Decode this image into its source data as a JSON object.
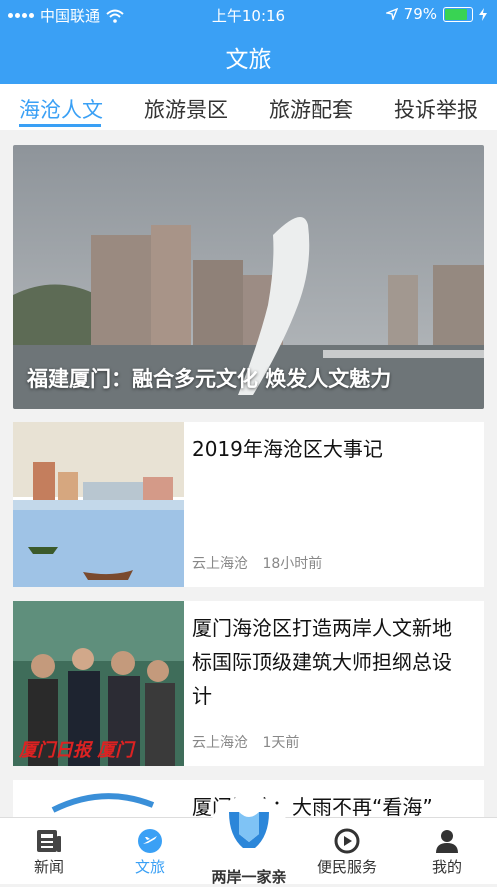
{
  "status_bar": {
    "carrier": "中国联通",
    "time": "上午10:16",
    "battery": "79%"
  },
  "header": {
    "title": "文旅"
  },
  "tabs": [
    {
      "label": "海沧人文",
      "active": true
    },
    {
      "label": "旅游景区",
      "active": false
    },
    {
      "label": "旅游配套",
      "active": false
    },
    {
      "label": "投诉举报",
      "active": false
    }
  ],
  "hero": {
    "caption": "福建厦门：融合多元文化 焕发人文魅力"
  },
  "articles": [
    {
      "title": "2019年海沧区大事记",
      "source": "云上海沧",
      "time": "18小时前"
    },
    {
      "title": "厦门海沧区打造两岸人文新地标国际顶级建筑大师担纲总设计",
      "source": "云上海沧",
      "time": "1天前",
      "image_text": "厦门日报 厦门"
    },
    {
      "title": "厦门海沧：大雨不再“看海”"
    }
  ],
  "bottom_nav": [
    {
      "label": "新闻",
      "icon": "news-icon"
    },
    {
      "label": "文旅",
      "icon": "travel-icon",
      "active": true
    },
    {
      "label": "两岸一家亲",
      "icon": "cross-strait-logo-icon"
    },
    {
      "label": "便民服务",
      "icon": "service-icon"
    },
    {
      "label": "我的",
      "icon": "user-icon"
    }
  ],
  "colors": {
    "primary": "#3aa0f5",
    "battery": "#39d353"
  }
}
